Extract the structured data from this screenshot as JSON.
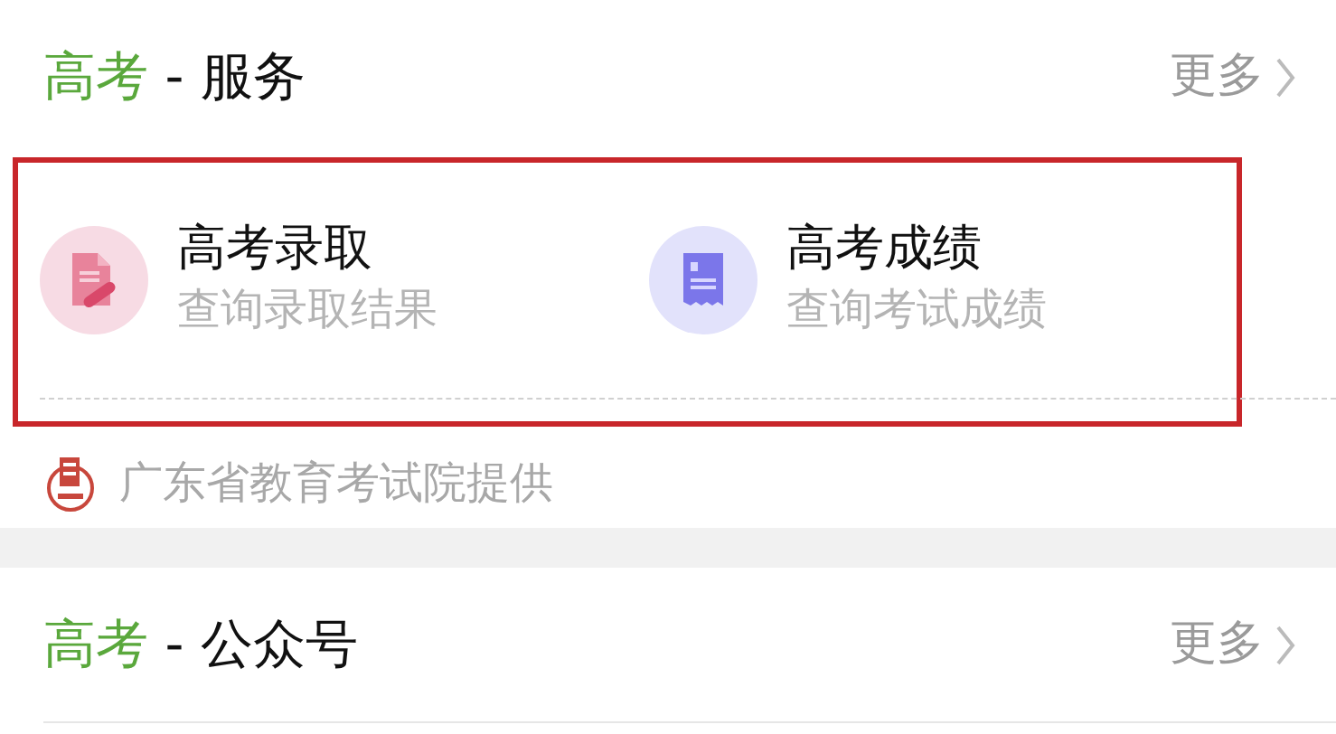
{
  "sections": [
    {
      "title_highlight": "高考",
      "title_rest": " - 服务",
      "more": "更多",
      "items": [
        {
          "title": "高考录取",
          "subtitle": "查询录取结果",
          "kind": "admission",
          "color": "#f7dbe4"
        },
        {
          "title": "高考成绩",
          "subtitle": "查询考试成绩",
          "kind": "score",
          "color": "#e2e2fb"
        }
      ],
      "highlighted": true,
      "source": "广东省教育考试院提供"
    },
    {
      "title_highlight": "高考",
      "title_rest": " - 公众号",
      "more": "更多"
    }
  ]
}
